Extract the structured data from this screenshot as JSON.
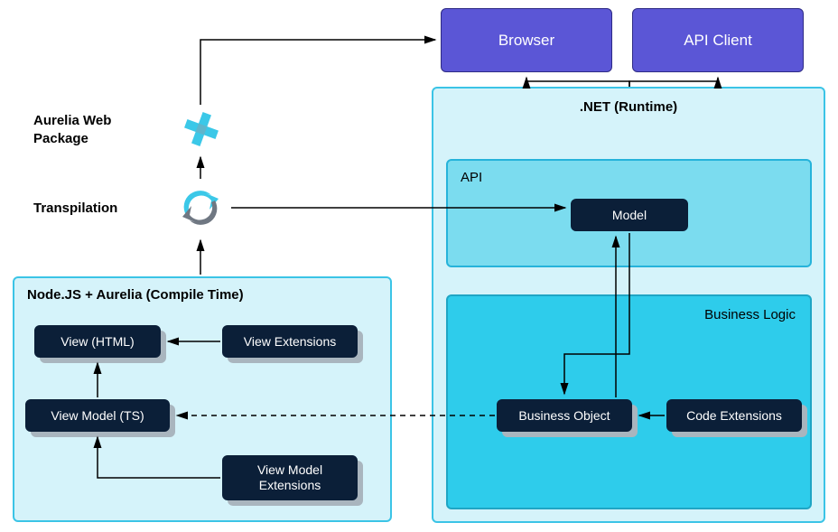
{
  "top": {
    "browser": "Browser",
    "apiClient": "API Client"
  },
  "left": {
    "aureliaPackage": "Aurelia Web Package",
    "transpilation": "Transpilation"
  },
  "compile": {
    "title": "Node.JS + Aurelia (Compile Time)",
    "viewHtml": "View (HTML)",
    "viewExtensions": "View Extensions",
    "viewModelTs": "View Model (TS)",
    "viewModelExtensions": "View Model Extensions"
  },
  "runtime": {
    "netRuntime": ".NET (Runtime)",
    "api": "API",
    "model": "Model",
    "businessLogic": "Business Logic",
    "businessObject": "Business Object",
    "codeExtensions": "Code Extensions"
  }
}
